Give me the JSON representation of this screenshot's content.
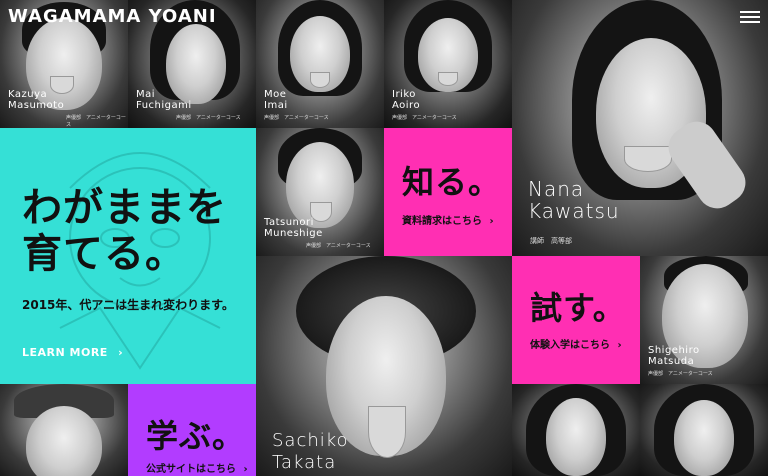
{
  "header": {
    "logo_text": "WAGAMAMA YOANI",
    "menu_icon": "hamburger-menu-icon"
  },
  "profiles": [
    {
      "first": "Kazuya",
      "last": "Masumoto",
      "role": "声優部　アニメーターコース"
    },
    {
      "first": "Mai",
      "last": "Fuchigami",
      "role": "声優部　アニメーターコース"
    },
    {
      "first": "Moe",
      "last": "Imai",
      "role": "声優部　アニメーターコース"
    },
    {
      "first": "Iriko",
      "last": "Aoiro",
      "role": "声優部　アニメーターコース"
    },
    {
      "first": "Tatsunori",
      "last": "Muneshige",
      "role": "声優部　アニメーターコース"
    },
    {
      "first": "Nana",
      "last": "Kawatsu",
      "role": "講師　高等部"
    },
    {
      "first": "Shigehiro",
      "last": "Matsuda",
      "role": "声優部　アニメーターコース"
    },
    {
      "first": "Sachiko",
      "last": "Takata",
      "role": ""
    }
  ],
  "hero": {
    "line1": "わがままを",
    "line2": "育てる。",
    "subtitle": "2015年、代アニは生まれ変わります。",
    "cta": "LEARN MORE"
  },
  "cards": {
    "know": {
      "title": "知る。",
      "link": "資料請求はこちら"
    },
    "try": {
      "title": "試す。",
      "link": "体験入学はこちら"
    },
    "learn": {
      "title": "学ぶ。",
      "link": "公式サイトはこちら"
    }
  },
  "colors": {
    "pink": "#ff2fb3",
    "purple": "#b23cff",
    "cyan": "#35e0d6"
  }
}
